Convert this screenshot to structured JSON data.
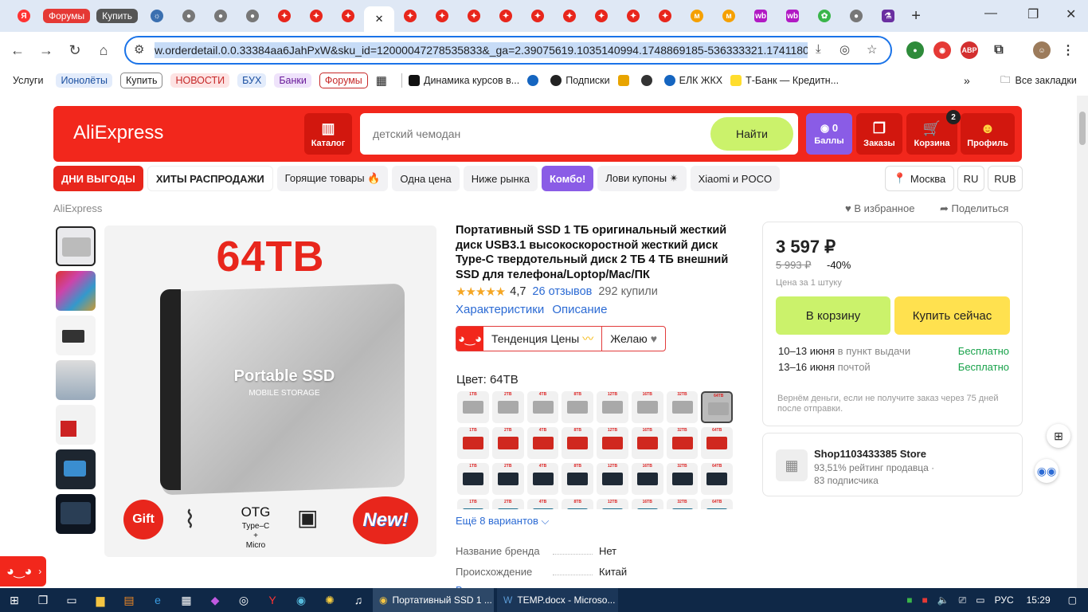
{
  "browser": {
    "tab_pills": [
      {
        "label": "Форумы",
        "color": "#e53935"
      },
      {
        "label": "Купить",
        "color": "#555555"
      }
    ],
    "active_tab_close": "✕",
    "new_tab": "+",
    "url": "w.orderdetail.0.0.33384aa6JahPxW&sku_id=12000047278535833&_ga=2.39075619.1035140994.1748869185-536333321.1741180196",
    "bookmarks": [
      {
        "label": "Услуги",
        "style": "plain"
      },
      {
        "label": "Ионолёты",
        "style": "blue"
      },
      {
        "label": "Купить",
        "style": "outline"
      },
      {
        "label": "НОВОСТИ",
        "style": "red"
      },
      {
        "label": "БУХ",
        "style": "blue"
      },
      {
        "label": "Банки",
        "style": "purple"
      },
      {
        "label": "Форумы",
        "style": "red-outline"
      }
    ],
    "bookmarks_links": [
      {
        "label": "Динамика курсов в...",
        "icon_color": "#111"
      },
      {
        "label": "Подписки",
        "icon_color": "#222"
      },
      {
        "label": "",
        "icon_color": "#e8a400"
      },
      {
        "label": "",
        "icon_color": "#333"
      },
      {
        "label": "ЕЛК ЖКХ",
        "icon_color": "#1565c0"
      },
      {
        "label": "Т-Банк — Кредитн...",
        "icon_color": "#ffdd2d"
      }
    ],
    "all_bookmarks": "Все закладки",
    "ext_abp": "ABP"
  },
  "header": {
    "logo": "AliExpress",
    "catalog": "Каталог",
    "search_placeholder": "детский чемодан",
    "search_button": "Найти",
    "balls_count": "0",
    "balls": "Баллы",
    "orders": "Заказы",
    "cart": "Корзина",
    "cart_badge": "2",
    "profile": "Профиль"
  },
  "nav_pills": [
    {
      "label": "ДНИ ВЫГОДЫ",
      "style": "red"
    },
    {
      "label": "ХИТЫ РАСПРОДАЖИ",
      "style": "white"
    },
    {
      "label": "Горящие товары 🔥",
      "style": "gray"
    },
    {
      "label": "Одна цена",
      "style": "gray"
    },
    {
      "label": "Ниже рынка",
      "style": "gray"
    },
    {
      "label": "Комбо!",
      "style": "violet"
    },
    {
      "label": "Лови купоны ✴",
      "style": "gray"
    },
    {
      "label": "Xiaomi и POCO",
      "style": "gray"
    }
  ],
  "region": {
    "city": "Москва",
    "lang": "RU",
    "currency": "RUB"
  },
  "breadcrumb": "AliExpress",
  "favorite": "В избранное",
  "share": "Поделиться",
  "product": {
    "image_title": "64TB",
    "image_brand": "Portable SSD",
    "image_sub": "MOBILE STORAGE",
    "image_gift": "Gift",
    "image_otg": "OTG",
    "image_otg_sub": "Type–C\n+\nMicro",
    "image_new": "New!",
    "title": "Портативный SSD 1 ТБ оригинальный жесткий диск USB3.1 высокоскоростной жесткий диск Type-C твердотельный диск 2 ТБ 4 ТБ внешний SSD для телефона/Loptop/Mac/ПК",
    "rating": "4,7",
    "stars_fraction": 0.94,
    "reviews": "26 отзывов",
    "bought": "292 купили",
    "link_specs": "Характеристики",
    "link_desc": "Описание",
    "trend": "Тенденция Цены",
    "wish": "Желаю",
    "color_label": "Цвет: 64TB",
    "capacities": [
      "1TB",
      "2TB",
      "4TB",
      "8TB",
      "12TB",
      "16TB",
      "32TB",
      "64TB"
    ],
    "variant_colors": [
      "#a9a9a9",
      "#d0281f",
      "#1f2a36",
      "#1c6d8c"
    ],
    "more_variants": "Ещё 8 вариантов",
    "specs": [
      {
        "k": "Название бренда",
        "v": "Нет"
      },
      {
        "k": "Происхождение",
        "v": "Китай"
      }
    ],
    "all_specs": "Все характеристики"
  },
  "buy": {
    "price": "3 597 ₽",
    "old_price": "5 993 ₽",
    "discount": "-40%",
    "per": "Цена за 1 штуку",
    "cart_btn": "В корзину",
    "buy_btn": "Купить сейчас",
    "delivery": [
      {
        "date": "10–13 июня",
        "how": "в пункт выдачи",
        "price": "Бесплатно"
      },
      {
        "date": "13–16 июня",
        "how": "почтой",
        "price": "Бесплатно"
      }
    ],
    "refund": "Вернём деньги, если не получите заказ через 75 дней после отправки."
  },
  "shop": {
    "name": "Shop1103433385 Store",
    "rating": "93,51% рейтинг продавца",
    "subs": "83 подписчика"
  },
  "taskbar": {
    "app1": "Портативный SSD 1 ...",
    "app2": "TEMP.docx - Microso...",
    "lang": "РУС",
    "time": "15:29"
  },
  "colors": {
    "brand_red": "#f2271c",
    "lime": "#cbf26b",
    "yellow": "#ffe14f",
    "link": "#2c6bd4"
  }
}
